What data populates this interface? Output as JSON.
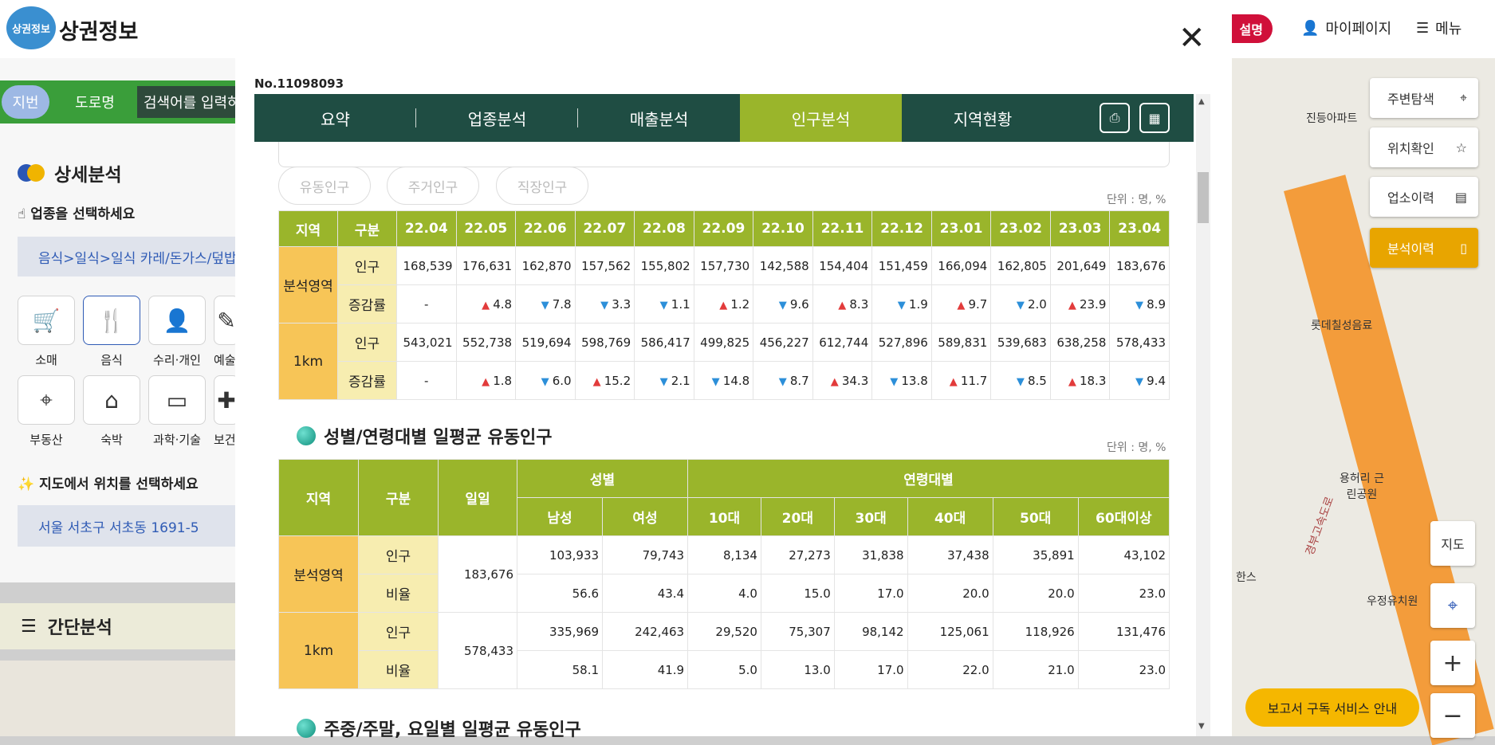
{
  "header": {
    "logo_badge": "상권정보",
    "site_title": "상권정보",
    "desc_button": "설명",
    "mypage": "마이페이지",
    "menu": "메뉴"
  },
  "left": {
    "tabs": [
      "지번",
      "도로명"
    ],
    "search_placeholder": "검색어를 입력하",
    "detail_title": "상세분석",
    "select_biz": "업종을 선택하세요",
    "biz_path": "음식>일식>일식 카레/돈가스/덮밥",
    "categories": [
      [
        "소매",
        "cart-icon"
      ],
      [
        "음식",
        "utensils-icon"
      ],
      [
        "수리·개인",
        "person-icon"
      ],
      [
        "예술",
        "art-icon"
      ],
      [
        "부동산",
        "location-pin-icon"
      ],
      [
        "숙박",
        "house-icon"
      ],
      [
        "과학·기술",
        "devices-icon"
      ],
      [
        "보건",
        "health-icon"
      ]
    ],
    "select_map": "지도에서 위치를 선택하세요",
    "address": "서울 서초구 서초동 1691-5",
    "simple": "간단분석"
  },
  "right": {
    "buttons": [
      "주변탐색",
      "위치확인",
      "업소이력",
      "분석이력"
    ],
    "map_btn": "지도",
    "zoom_in": "+",
    "zoom_out": "−",
    "subscribe": "보고서 구독 서비스 안내",
    "labels": [
      "진등아파트",
      "롯데칠성음료",
      "용허리 근린공원",
      "한스",
      "우정유치원",
      "경부고속도로"
    ]
  },
  "modal": {
    "store_no": "No.11098093",
    "tabs": [
      "요약",
      "업종분석",
      "매출분석",
      "인구분석",
      "지역현황"
    ],
    "active_tab": "인구분석",
    "sub_tabs": [
      "유동인구",
      "주거인구",
      "직장인구"
    ],
    "unit": "단위 : 명, %",
    "monthly": {
      "head": [
        "지역",
        "구분",
        "22.04",
        "22.05",
        "22.06",
        "22.07",
        "22.08",
        "22.09",
        "22.10",
        "22.11",
        "22.12",
        "23.01",
        "23.02",
        "23.03",
        "23.04"
      ],
      "regions": [
        {
          "name": "분석영역",
          "pop_label": "인구",
          "rate_label": "증감률",
          "pop": [
            "168,539",
            "176,631",
            "162,870",
            "157,562",
            "155,802",
            "157,730",
            "142,588",
            "154,404",
            "151,459",
            "166,094",
            "162,805",
            "201,649",
            "183,676"
          ],
          "rate": [
            "-",
            "4.8",
            "7.8",
            "3.3",
            "1.1",
            "1.2",
            "9.6",
            "8.3",
            "1.9",
            "9.7",
            "2.0",
            "23.9",
            "8.9"
          ],
          "dir": [
            "",
            "up",
            "dn",
            "dn",
            "dn",
            "up",
            "dn",
            "up",
            "dn",
            "up",
            "dn",
            "up",
            "dn"
          ]
        },
        {
          "name": "1km",
          "pop_label": "인구",
          "rate_label": "증감률",
          "pop": [
            "543,021",
            "552,738",
            "519,694",
            "598,769",
            "586,417",
            "499,825",
            "456,227",
            "612,744",
            "527,896",
            "589,831",
            "539,683",
            "638,258",
            "578,433"
          ],
          "rate": [
            "-",
            "1.8",
            "6.0",
            "15.2",
            "2.1",
            "14.8",
            "8.7",
            "34.3",
            "13.8",
            "11.7",
            "8.5",
            "18.3",
            "9.4"
          ],
          "dir": [
            "",
            "up",
            "dn",
            "up",
            "dn",
            "dn",
            "dn",
            "up",
            "dn",
            "up",
            "dn",
            "up",
            "dn"
          ]
        }
      ]
    },
    "gender_age": {
      "title": "성별/연령대별 일평균 유동인구",
      "head_top": [
        "지역",
        "구분",
        "일일",
        "성별",
        "연령대별"
      ],
      "head_sub": [
        "남성",
        "여성",
        "10대",
        "20대",
        "30대",
        "40대",
        "50대",
        "60대이상"
      ],
      "regions": [
        {
          "name": "분석영역",
          "daily": "183,676",
          "rows": [
            [
              "인구",
              "103,933",
              "79,743",
              "8,134",
              "27,273",
              "31,838",
              "37,438",
              "35,891",
              "43,102"
            ],
            [
              "비율",
              "56.6",
              "43.4",
              "4.0",
              "15.0",
              "17.0",
              "20.0",
              "20.0",
              "23.0"
            ]
          ]
        },
        {
          "name": "1km",
          "daily": "578,433",
          "rows": [
            [
              "인구",
              "335,969",
              "242,463",
              "29,520",
              "75,307",
              "98,142",
              "125,061",
              "118,926",
              "131,476"
            ],
            [
              "비율",
              "58.1",
              "41.9",
              "5.0",
              "13.0",
              "17.0",
              "22.0",
              "21.0",
              "23.0"
            ]
          ]
        }
      ]
    },
    "next_title": "주중/주말, 요일별 일평균 유동인구"
  }
}
